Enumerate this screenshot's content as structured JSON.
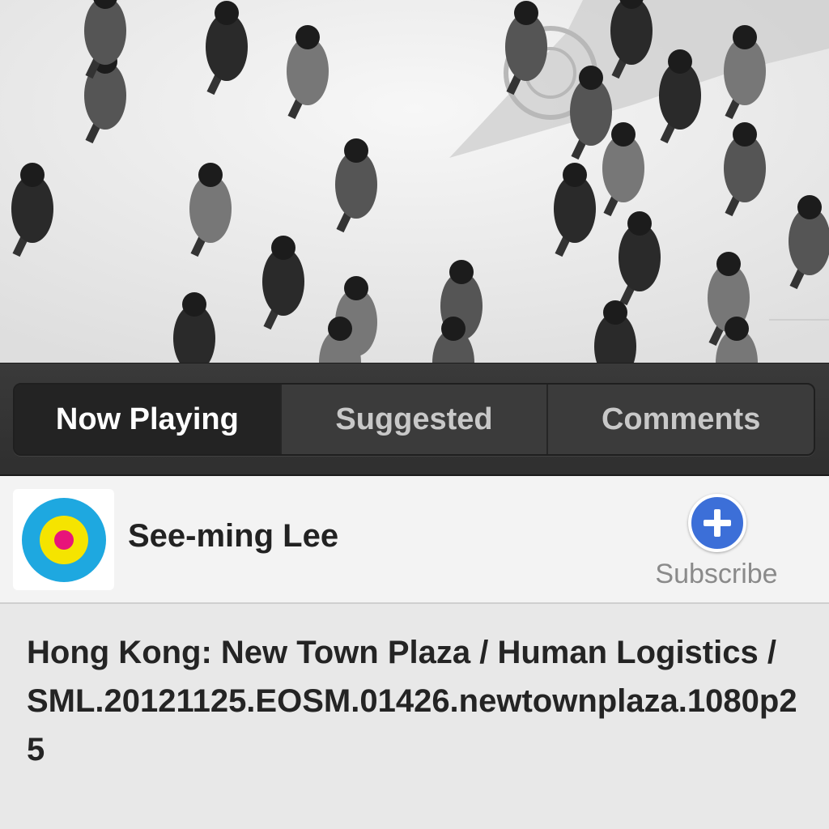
{
  "video": {
    "thumbnail_icon": "video-thumbnail"
  },
  "tabs": [
    {
      "label": "Now Playing",
      "active": true
    },
    {
      "label": "Suggested",
      "active": false
    },
    {
      "label": "Comments",
      "active": false
    }
  ],
  "channel": {
    "name": "See-ming Lee",
    "avatar_icon": "target-logo-icon",
    "avatar_colors": [
      "#1ea8e0",
      "#f5e400",
      "#e8147a"
    ],
    "subscribe_label": "Subscribe",
    "subscribe_icon": "plus-icon",
    "accent": "#3c6fd8"
  },
  "video_title": "Hong Kong: New Town Plaza / Human Logistics / SML.20121125.EOSM.01426.newtownplaza.1080p25"
}
